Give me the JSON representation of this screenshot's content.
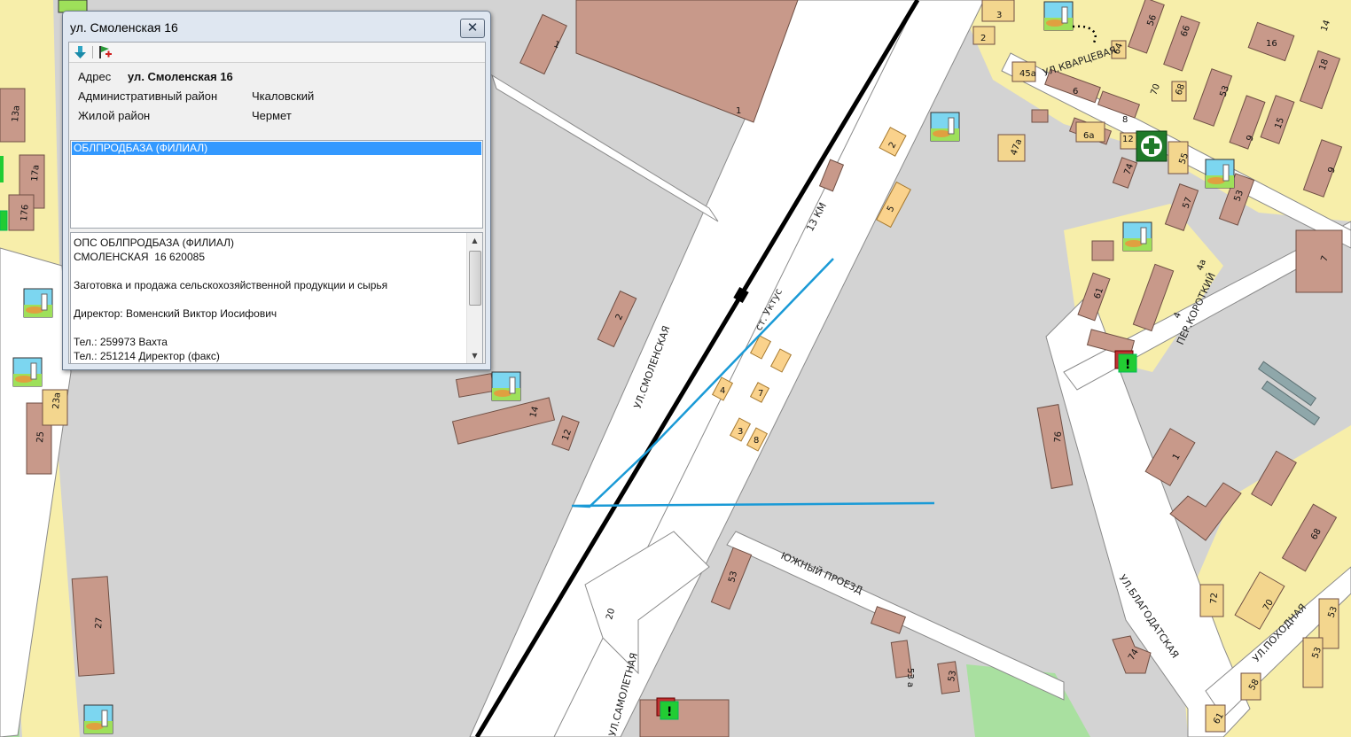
{
  "window": {
    "title": "ул. Смоленская 16",
    "close_label": "✕",
    "properties": [
      {
        "key": "Адрес",
        "value": "ул. Смоленская 16"
      },
      {
        "key": "Административный район",
        "value": "Чкаловский"
      },
      {
        "key": "Жилой район",
        "value": "Чермет"
      }
    ],
    "list_items": [
      "ОБЛПРОДБАЗА (ФИЛИАЛ)"
    ],
    "description": "ОПС ОБЛПРОДБАЗА (ФИЛИАЛ)\nСМОЛЕНСКАЯ  16 620085\n\nЗаготовка и продажа сельскохозяйственной продукции и сырья\n\nДиректор: Воменский Виктор Иосифович\n\nТел.: 259973 Вахта\nТел.: 251214 Директор (факс)"
  },
  "map": {
    "street_labels": {
      "smolenskaya": "УЛ.СМОЛЕНСКАЯ",
      "km13": "13 КМ",
      "uktus": "ст. Уктус",
      "yuzhny": "ЮЖНЫЙ ПРОЕЗД",
      "samoletnaya": "УЛ.САМОЛЕТНАЯ",
      "blagodatskaya": "УЛ.БЛАГОДАТСКАЯ",
      "pokhodnaya": "УЛ.ПОХОДНАЯ",
      "korotky": "ПЕР.КОРОТКИЙ",
      "kvartsevaya": "УЛ.КВАРЦЕВАЯ"
    },
    "building_numbers": {
      "b1top": "1",
      "b1sq": "1",
      "b2a": "2",
      "b2b": "2",
      "b5": "5",
      "b14": "14",
      "b12": "12",
      "b4": "4",
      "b7": "7",
      "b3": "3",
      "b8": "8",
      "b53": "53",
      "b53a": "53 а",
      "b53b": "53",
      "b20": "20",
      "b27": "27",
      "b25": "25",
      "b23a": "23а",
      "b17a": "17а",
      "b13a": "13а",
      "b176": "176",
      "b76": "76",
      "b1r": "1",
      "b68": "68",
      "b70": "70",
      "b72": "72",
      "b74": "74",
      "b58": "58",
      "b61": "61",
      "b53c": "53",
      "b57": "57",
      "b55": "55",
      "b61b": "61",
      "b4b": "4",
      "b4a": "4а",
      "b74b": "74",
      "b47a": "47а",
      "b45a": "45а",
      "b6": "6",
      "b6a": "6а",
      "b8b": "8",
      "b12b": "12",
      "b70b": "70",
      "b68b": "68",
      "b3b": "3",
      "b2c": "2",
      "b64": "64",
      "b56": "56",
      "b66": "66",
      "b16": "16",
      "b14b": "14",
      "b18": "18",
      "b53d": "53",
      "b15": "15",
      "b9": "9",
      "b9b": "9",
      "b7b": "7",
      "b53e": "53",
      "b53f": "53"
    },
    "colors": {
      "road": "#ffffff",
      "block": "#d3d3d3",
      "building": "#c8998a",
      "residential": "#f7eeaa",
      "small_building": "#fad28c",
      "route": "#1a9ad6",
      "green": "#a9e0a0"
    }
  },
  "toolbar": {
    "icons": [
      "arrow-down-icon",
      "flag-icon"
    ]
  }
}
